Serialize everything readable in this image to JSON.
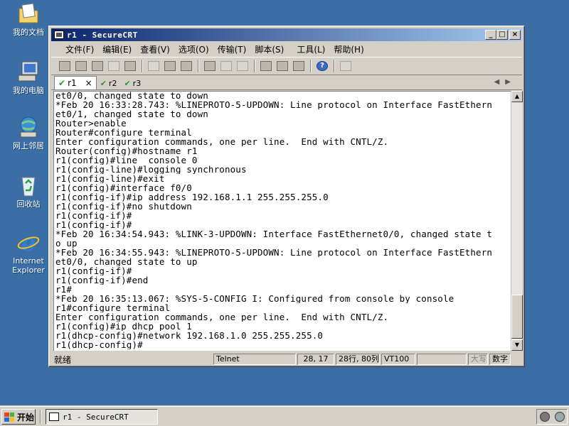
{
  "desktop": {
    "icons": [
      {
        "label": "我的文档",
        "icon": "my-documents-icon"
      },
      {
        "label": "我的电脑",
        "icon": "my-computer-icon"
      },
      {
        "label": "网上邻居",
        "icon": "network-places-icon"
      },
      {
        "label": "回收站",
        "icon": "recycle-bin-icon"
      },
      {
        "label": "Internet\nExplorer",
        "icon": "internet-explorer-icon"
      }
    ]
  },
  "window": {
    "title": "r1 - SecureCRT",
    "controls": {
      "minimize": "_",
      "maximize": "□",
      "close": "×"
    },
    "menu": [
      "文件(F)",
      "编辑(E)",
      "查看(V)",
      "选项(O)",
      "传输(T)",
      "脚本(S)",
      "工具(L)",
      "帮助(H)"
    ],
    "toolbar_icons": [
      "connect-icon",
      "quick-connect-icon",
      "connect-tab-icon",
      "reconnect-icon",
      "disconnect-icon",
      "copy-icon",
      "paste-icon",
      "find-icon",
      "print-icon",
      "print-selection-icon",
      "print-setup-icon",
      "session-options-icon",
      "global-options-icon",
      "keymap-icon",
      "help-icon",
      "sftp-icon"
    ],
    "tabs": [
      {
        "label": "r1",
        "active": true,
        "close": "×"
      },
      {
        "label": "r2",
        "active": false
      },
      {
        "label": "r3",
        "active": false
      }
    ],
    "tab_nav": {
      "prev": "◀",
      "next": "▶"
    },
    "terminal_lines": [
      "et0/0, changed state to down",
      "*Feb 20 16:33:28.743: %LINEPROTO-5-UPDOWN: Line protocol on Interface FastEthern",
      "et0/1, changed state to down",
      "Router>enable",
      "Router#configure terminal",
      "Enter configuration commands, one per line.  End with CNTL/Z.",
      "Router(config)#hostname r1",
      "r1(config)#line  console 0",
      "r1(config-line)#logging synchronous",
      "r1(config-line)#exit",
      "r1(config)#interface f0/0",
      "r1(config-if)#ip address 192.168.1.1 255.255.255.0",
      "r1(config-if)#no shutdown",
      "r1(config-if)#",
      "r1(config-if)#",
      "*Feb 20 16:34:54.943: %LINK-3-UPDOWN: Interface FastEthernet0/0, changed state t",
      "o up",
      "*Feb 20 16:34:55.943: %LINEPROTO-5-UPDOWN: Line protocol on Interface FastEthern",
      "et0/0, changed state to up",
      "r1(config-if)#",
      "r1(config-if)#end",
      "r1#",
      "*Feb 20 16:35:13.067: %SYS-5-CONFIG_I: Configured from console by console",
      "r1#configure terminal",
      "Enter configuration commands, one per line.  End with CNTL/Z.",
      "r1(config)#ip dhcp pool 1",
      "r1(dhcp-config)#network 192.168.1.0 255.255.255.0",
      "r1(dhcp-config)#"
    ],
    "status": {
      "ready": "就绪",
      "protocol": "Telnet",
      "cursor": "28, 17",
      "size": "28行, 80列",
      "terminal_type": "VT100",
      "blank": "",
      "caps": "大写",
      "num": "数字"
    }
  },
  "taskbar": {
    "start_label": "开始",
    "task_title": "r1 - SecureCRT"
  }
}
